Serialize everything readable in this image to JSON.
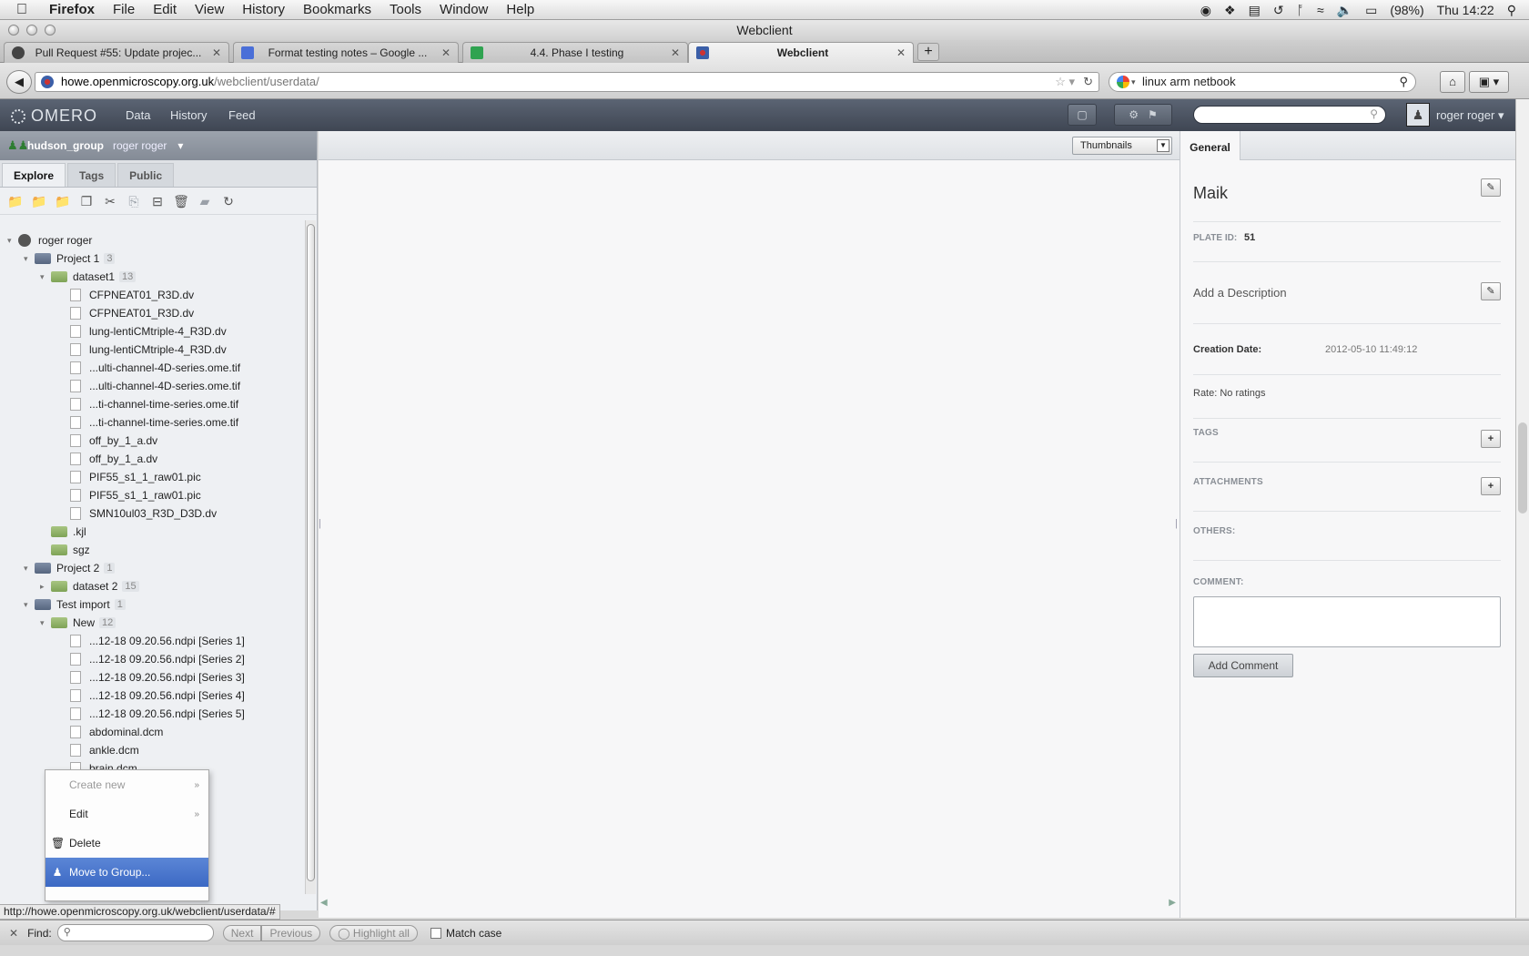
{
  "menubar": {
    "app": "Firefox",
    "items": [
      "File",
      "Edit",
      "View",
      "History",
      "Bookmarks",
      "Tools",
      "Window",
      "Help"
    ],
    "battery": "(98%)",
    "clock": "Thu 14:22"
  },
  "window": {
    "title": "Webclient"
  },
  "tabs": [
    {
      "title": "Pull Request #55: Update projec...",
      "favicon_color": "#444444"
    },
    {
      "title": "Format testing notes – Google ...",
      "favicon_color": "#4a6fd8"
    },
    {
      "title": "4.4. Phase I testing",
      "favicon_color": "#2fa350"
    },
    {
      "title": "Webclient",
      "favicon_color": "#3b5fa8"
    }
  ],
  "navbar": {
    "url_host": "howe.openmicroscopy.org.uk",
    "url_path": "/webclient/userdata/",
    "search_value": "linux arm netbook"
  },
  "omero": {
    "logo": "OMERO",
    "nav": [
      "Data",
      "History",
      "Feed"
    ],
    "user": "roger roger"
  },
  "left": {
    "group": "hudson_group",
    "user": "roger roger",
    "tabs": [
      "Explore",
      "Tags",
      "Public"
    ],
    "tree": [
      {
        "label": "roger roger",
        "type": "user",
        "level": 0,
        "twisty": "open"
      },
      {
        "label": "Project 1",
        "type": "project",
        "level": 1,
        "count": "3",
        "twisty": "open"
      },
      {
        "label": "dataset1",
        "type": "dataset",
        "level": 2,
        "count": "13",
        "twisty": "open"
      },
      {
        "label": "CFPNEAT01_R3D.dv",
        "type": "image",
        "level": 3
      },
      {
        "label": "CFPNEAT01_R3D.dv",
        "type": "image",
        "level": 3
      },
      {
        "label": "lung-lentiCMtriple-4_R3D.dv",
        "type": "image",
        "level": 3
      },
      {
        "label": "lung-lentiCMtriple-4_R3D.dv",
        "type": "image",
        "level": 3
      },
      {
        "label": "...ulti-channel-4D-series.ome.tif",
        "type": "image",
        "level": 3
      },
      {
        "label": "...ulti-channel-4D-series.ome.tif",
        "type": "image",
        "level": 3
      },
      {
        "label": "...ti-channel-time-series.ome.tif",
        "type": "image",
        "level": 3
      },
      {
        "label": "...ti-channel-time-series.ome.tif",
        "type": "image",
        "level": 3
      },
      {
        "label": "off_by_1_a.dv",
        "type": "image",
        "level": 3
      },
      {
        "label": "off_by_1_a.dv",
        "type": "image",
        "level": 3
      },
      {
        "label": "PIF55_s1_1_raw01.pic",
        "type": "image",
        "level": 3
      },
      {
        "label": "PIF55_s1_1_raw01.pic",
        "type": "image",
        "level": 3
      },
      {
        "label": "SMN10ul03_R3D_D3D.dv",
        "type": "image",
        "level": 3
      },
      {
        "label": ".kjl",
        "type": "dataset",
        "level": 2
      },
      {
        "label": "sgz",
        "type": "dataset",
        "level": 2
      },
      {
        "label": "Project 2",
        "type": "project",
        "level": 1,
        "count": "1",
        "twisty": "open"
      },
      {
        "label": "dataset 2",
        "type": "dataset",
        "level": 2,
        "count": "15",
        "twisty": "closed"
      },
      {
        "label": "Test import",
        "type": "project",
        "level": 1,
        "count": "1",
        "twisty": "open"
      },
      {
        "label": "New",
        "type": "dataset",
        "level": 2,
        "count": "12",
        "twisty": "open"
      },
      {
        "label": "...12-18 09.20.56.ndpi [Series 1]",
        "type": "image",
        "level": 3
      },
      {
        "label": "...12-18 09.20.56.ndpi [Series 2]",
        "type": "image",
        "level": 3
      },
      {
        "label": "...12-18 09.20.56.ndpi [Series 3]",
        "type": "image",
        "level": 3
      },
      {
        "label": "...12-18 09.20.56.ndpi [Series 4]",
        "type": "image",
        "level": 3
      },
      {
        "label": "...12-18 09.20.56.ndpi [Series 5]",
        "type": "image",
        "level": 3
      },
      {
        "label": "abdominal.dcm",
        "type": "image",
        "level": 3
      },
      {
        "label": "ankle.dcm",
        "type": "image",
        "level": 3
      },
      {
        "label": "brain.dcm",
        "type": "image",
        "level": 3
      }
    ]
  },
  "context_menu": {
    "items": [
      {
        "label": "Create new",
        "disabled": true,
        "submenu": true,
        "icon": ""
      },
      {
        "label": "Edit",
        "disabled": false,
        "submenu": true,
        "icon": ""
      },
      {
        "label": "Delete",
        "disabled": false,
        "submenu": false,
        "icon": "trash-icon"
      },
      {
        "label": "Move to Group...",
        "disabled": false,
        "submenu": false,
        "icon": "user-icon",
        "highlighted": true
      }
    ]
  },
  "center": {
    "view_mode": "Thumbnails"
  },
  "right": {
    "tab": "General",
    "name": "Maik",
    "plate_id_label": "PLATE ID:",
    "plate_id": "51",
    "description_placeholder": "Add a Description",
    "creation_label": "Creation Date:",
    "creation_value": "2012-05-10 11:49:12",
    "rate": "Rate: No ratings",
    "tags_label": "TAGS",
    "attachments_label": "ATTACHMENTS",
    "others_label": "OTHERS:",
    "comment_label": "COMMENT:",
    "add_comment": "Add Comment"
  },
  "status_url": "http://howe.openmicroscopy.org.uk/webclient/userdata/#",
  "findbar": {
    "label": "Find:",
    "next": "Next",
    "previous": "Previous",
    "highlight": "Highlight all",
    "match_case": "Match case"
  }
}
